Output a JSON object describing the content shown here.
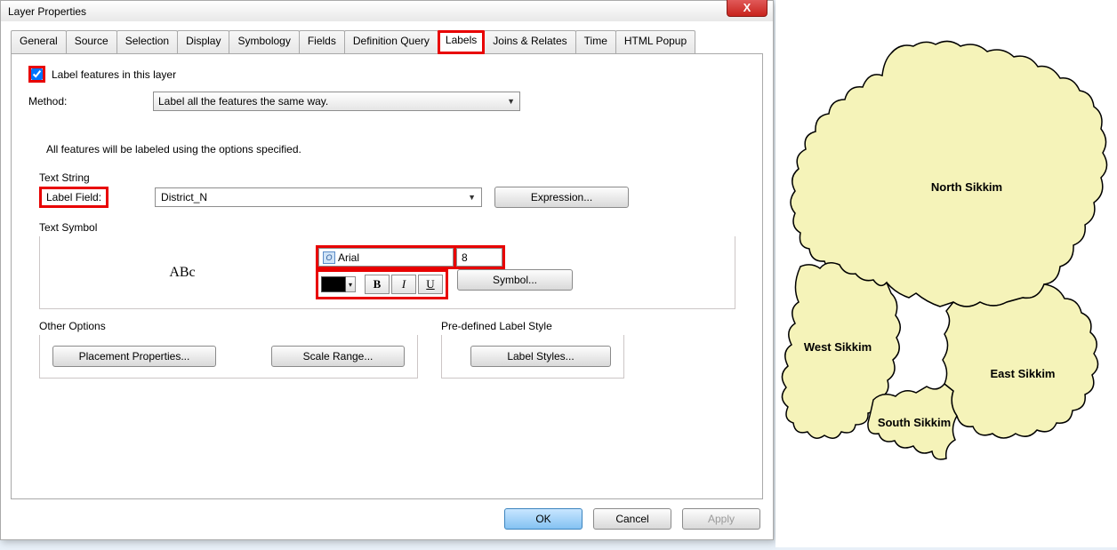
{
  "dialog_title": "Layer Properties",
  "tabs": [
    "General",
    "Source",
    "Selection",
    "Display",
    "Symbology",
    "Fields",
    "Definition Query",
    "Labels",
    "Joins & Relates",
    "Time",
    "HTML Popup"
  ],
  "active_tab": "Labels",
  "checkbox_label": "Label features in this layer",
  "method_label": "Method:",
  "method_value": "Label all the features the same way.",
  "description": "All features will be labeled using the options specified.",
  "text_string_label": "Text String",
  "label_field_label": "Label Field:",
  "label_field_value": "District_N",
  "expression_button": "Expression...",
  "text_symbol_label": "Text Symbol",
  "preview_text": "ABc",
  "font_name": "Arial",
  "font_size": "8",
  "bold_label": "B",
  "italic_label": "I",
  "underline_label": "U",
  "symbol_button": "Symbol...",
  "other_options_label": "Other Options",
  "placement_button": "Placement Properties...",
  "scale_range_button": "Scale Range...",
  "predefined_label": "Pre-defined Label Style",
  "label_styles_button": "Label Styles...",
  "ok_label": "OK",
  "cancel_label": "Cancel",
  "apply_label": "Apply",
  "close_icon": "X",
  "map": {
    "labels": {
      "north": "North Sikkim",
      "west": "West Sikkim",
      "south": "South Sikkim",
      "east": "East Sikkim"
    }
  }
}
